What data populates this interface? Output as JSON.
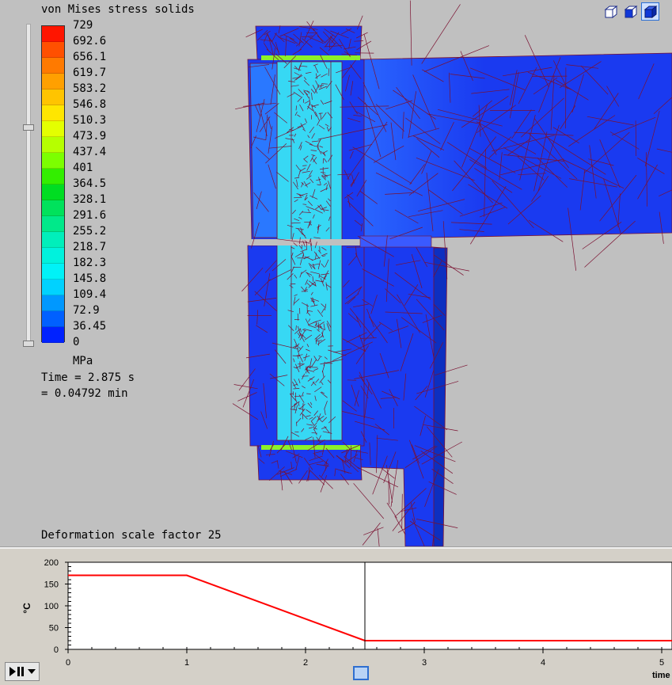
{
  "legend": {
    "title": "von Mises stress solids",
    "unit": "MPa",
    "labels": [
      "729",
      "692.6",
      "656.1",
      "619.7",
      "583.2",
      "546.8",
      "510.3",
      "473.9",
      "437.4",
      "401",
      "364.5",
      "328.1",
      "291.6",
      "255.2",
      "218.7",
      "182.3",
      "145.8",
      "109.4",
      "72.9",
      "36.45",
      "0"
    ],
    "colors": [
      "#ff1500",
      "#ff5000",
      "#ff7a00",
      "#ffa000",
      "#ffc400",
      "#ffe600",
      "#e4ff00",
      "#b6ff00",
      "#7cff00",
      "#33ee00",
      "#00dd22",
      "#00e25c",
      "#00e98a",
      "#00efbb",
      "#00f2dd",
      "#00f2f7",
      "#00d2ff",
      "#0098ff",
      "#0060ff",
      "#0022ff"
    ]
  },
  "time_readout": {
    "seconds": "Time = 2.875 s",
    "minutes": "= 0.04792 min"
  },
  "deformation_label": "Deformation scale factor 25",
  "view_buttons": [
    "wireframe-cube-icon",
    "half-shaded-cube-icon",
    "shaded-cube-icon"
  ],
  "scene_colors": {
    "background": "#c0c0c0",
    "base": "#1a3af0",
    "mid": "#2a66ff",
    "light": "#37d8f4",
    "mesh": "#7a1030",
    "hot": "#8cf02a"
  },
  "graph": {
    "y_unit": "°C",
    "x_unit": "time",
    "y_ticks": [
      "200",
      "150",
      "100",
      "50",
      "0"
    ],
    "x_ticks": [
      "0",
      "1",
      "2",
      "3",
      "4",
      "5"
    ],
    "line_color": "#ff0000"
  },
  "chart_data": {
    "type": "line",
    "x": [
      0,
      1,
      2.5,
      5.1
    ],
    "series": [
      {
        "values": [
          170,
          170,
          20,
          20
        ]
      }
    ],
    "xlim": [
      0,
      5.1
    ],
    "ylim": [
      0,
      200
    ],
    "current_time": 2.5
  }
}
